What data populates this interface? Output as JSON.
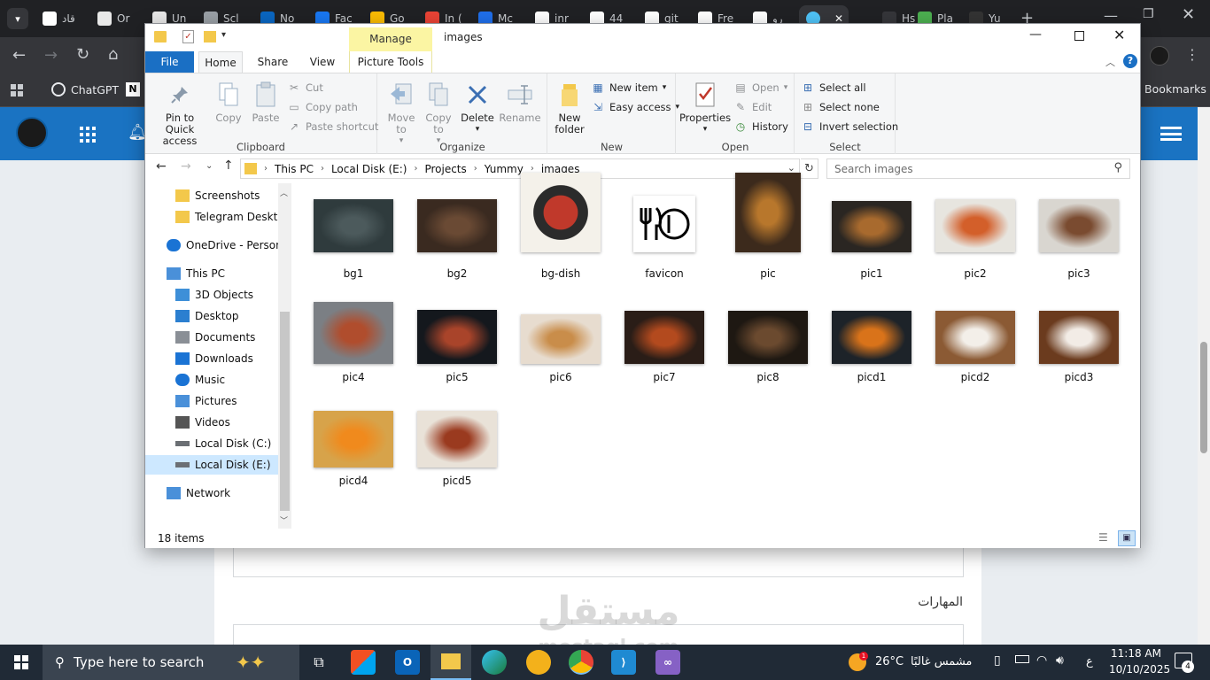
{
  "browser": {
    "tabs": [
      {
        "label": "قاد",
        "color": "#ffffff"
      },
      {
        "label": "Or",
        "color": "#e8e8e8"
      },
      {
        "label": "Un",
        "color": "#e8e8e8"
      },
      {
        "label": "Scl",
        "color": "#9aa0a6"
      },
      {
        "label": "No",
        "color": "#0a66c2"
      },
      {
        "label": "Fac",
        "color": "#1877f2"
      },
      {
        "label": "Go",
        "color": "#fbbc04"
      },
      {
        "label": "In (",
        "color": "#ea4335"
      },
      {
        "label": "Mc",
        "color": "#1f6feb"
      },
      {
        "label": "inr",
        "color": "#ffffff"
      },
      {
        "label": "44",
        "color": "#ffffff"
      },
      {
        "label": "git",
        "color": "#ffffff"
      },
      {
        "label": "Fre",
        "color": "#ffffff"
      },
      {
        "label": "رو",
        "color": "#ffffff"
      },
      {
        "label": "",
        "color": "#4fc3f7"
      },
      {
        "label": "Hs",
        "color": "#35363a"
      },
      {
        "label": "Pla",
        "color": "#4caf50"
      },
      {
        "label": "Yu",
        "color": "#333333"
      }
    ],
    "bookmarks": {
      "chatgpt": "ChatGPT",
      "all": "Bookmarks"
    }
  },
  "website": {
    "section_label": "المهارات",
    "watermark": "مستقل",
    "watermark_sub": "mostaql.com"
  },
  "explorer": {
    "title": "images",
    "contextual_tab": "Manage",
    "tabs": [
      "File",
      "Home",
      "Share",
      "View",
      "Picture Tools"
    ],
    "ribbon": {
      "clipboard": {
        "label": "Clipboard",
        "pin": "Pin to Quick access",
        "copy": "Copy",
        "paste": "Paste",
        "cut": "Cut",
        "copy_path": "Copy path",
        "paste_shortcut": "Paste shortcut"
      },
      "organize": {
        "label": "Organize",
        "move_to": "Move to",
        "copy_to": "Copy to",
        "delete": "Delete",
        "rename": "Rename"
      },
      "new": {
        "label": "New",
        "new_folder": "New folder",
        "new_item": "New item",
        "easy_access": "Easy access"
      },
      "open": {
        "label": "Open",
        "properties": "Properties",
        "open": "Open",
        "edit": "Edit",
        "history": "History"
      },
      "select": {
        "label": "Select",
        "select_all": "Select all",
        "select_none": "Select none",
        "invert": "Invert selection"
      }
    },
    "address": [
      "This PC",
      "Local Disk (E:)",
      "Projects",
      "Yummy",
      "images"
    ],
    "search_placeholder": "Search images",
    "nav": [
      {
        "label": "Screenshots",
        "icon": "folder-icon"
      },
      {
        "label": "Telegram Desktop",
        "icon": "folder-icon"
      },
      {
        "label": "OneDrive - Persona",
        "icon": "cloud-icon"
      },
      {
        "label": "This PC",
        "icon": "computer-icon"
      },
      {
        "label": "3D Objects",
        "icon": "cube-icon"
      },
      {
        "label": "Desktop",
        "icon": "desktop-icon"
      },
      {
        "label": "Documents",
        "icon": "document-icon"
      },
      {
        "label": "Downloads",
        "icon": "download-icon"
      },
      {
        "label": "Music",
        "icon": "music-icon"
      },
      {
        "label": "Pictures",
        "icon": "picture-icon"
      },
      {
        "label": "Videos",
        "icon": "video-icon"
      },
      {
        "label": "Local Disk (C:)",
        "icon": "drive-icon"
      },
      {
        "label": "Local Disk (E:)",
        "icon": "drive-icon"
      },
      {
        "label": "Network",
        "icon": "network-icon"
      }
    ],
    "files": [
      {
        "name": "bg1",
        "colors": [
          "#2f3b3d",
          "#4c5a5c"
        ]
      },
      {
        "name": "bg2",
        "colors": [
          "#3a2a20",
          "#6a4a34"
        ]
      },
      {
        "name": "bg-dish",
        "colors": [
          "#f4f1ea",
          "#c0392b"
        ]
      },
      {
        "name": "favicon",
        "colors": [
          "#ffffff",
          "#000000"
        ]
      },
      {
        "name": "pic",
        "colors": [
          "#3c2a1c",
          "#b8772c"
        ]
      },
      {
        "name": "pic1",
        "colors": [
          "#2a2622",
          "#a86a2e"
        ]
      },
      {
        "name": "pic2",
        "colors": [
          "#e7e5df",
          "#d35f2a"
        ]
      },
      {
        "name": "pic3",
        "colors": [
          "#d9d6d0",
          "#7a4b30"
        ]
      },
      {
        "name": "pic4",
        "colors": [
          "#7b7f84",
          "#b04d2d"
        ]
      },
      {
        "name": "pic5",
        "colors": [
          "#14181d",
          "#a9442a"
        ]
      },
      {
        "name": "pic6",
        "colors": [
          "#e7dccf",
          "#c98d4a"
        ]
      },
      {
        "name": "pic7",
        "colors": [
          "#2a1d17",
          "#b34a1e"
        ]
      },
      {
        "name": "pic8",
        "colors": [
          "#1e1812",
          "#6b4a2f"
        ]
      },
      {
        "name": "picd1",
        "colors": [
          "#1d2329",
          "#d9731a"
        ]
      },
      {
        "name": "picd2",
        "colors": [
          "#8b5a34",
          "#f3efe9"
        ]
      },
      {
        "name": "picd3",
        "colors": [
          "#6b3b1e",
          "#f2ece6"
        ]
      },
      {
        "name": "picd4",
        "colors": [
          "#d7a34a",
          "#f08a1d"
        ]
      },
      {
        "name": "picd5",
        "colors": [
          "#e9e2d8",
          "#9a3a1f"
        ]
      }
    ],
    "status": "18 items"
  },
  "taskbar": {
    "search_placeholder": "Type here to search",
    "weather": "26°C",
    "weather_text": "مشمس غالبًا",
    "time": "11:18 AM",
    "date": "10/10/2025",
    "lang": "ع",
    "notifications": "4"
  }
}
